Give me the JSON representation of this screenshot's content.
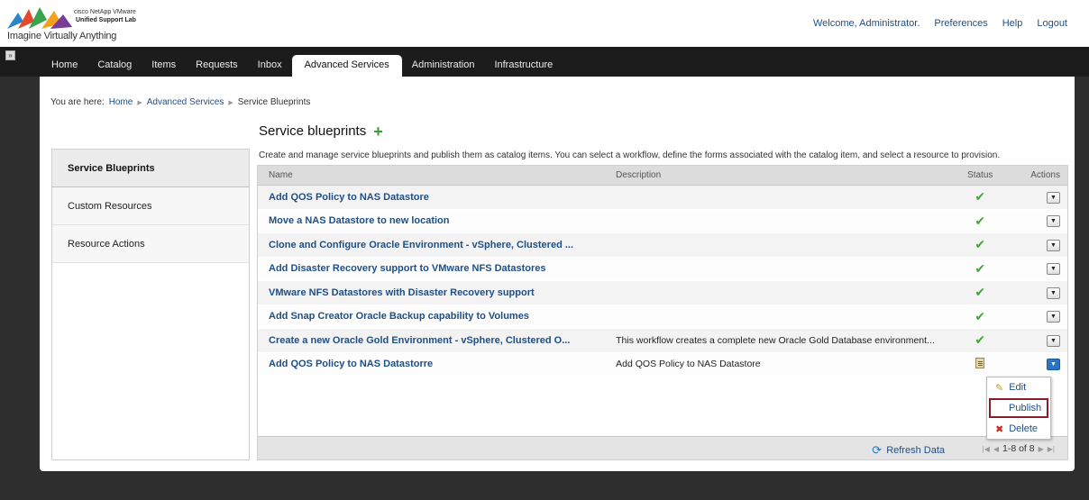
{
  "header": {
    "tagline": "Imagine Virtually Anything",
    "brand_small": "cisco  NetApp  VMware",
    "brand_lab": "Unified Support Lab",
    "welcome": "Welcome, Administrator.",
    "links": [
      "Preferences",
      "Help",
      "Logout"
    ]
  },
  "nav": {
    "toggle": "»",
    "tabs": [
      "Home",
      "Catalog",
      "Items",
      "Requests",
      "Inbox",
      "Advanced Services",
      "Administration",
      "Infrastructure"
    ],
    "active_tab": "Advanced Services"
  },
  "breadcrumb": {
    "prefix": "You are here:",
    "items": [
      "Home",
      "Advanced Services",
      "Service Blueprints"
    ]
  },
  "page": {
    "title": "Service blueprints",
    "description": "Create and manage service blueprints and publish them as catalog items. You can select a workflow, define the forms associated with the catalog item, and select a resource to provision."
  },
  "sidebar": {
    "items": [
      {
        "label": "Service Blueprints",
        "active": true
      },
      {
        "label": "Custom Resources",
        "active": false
      },
      {
        "label": "Resource Actions",
        "active": false
      }
    ]
  },
  "table": {
    "columns": [
      "Name",
      "Description",
      "Status",
      "Actions"
    ],
    "rows": [
      {
        "name": "Add QOS Policy to NAS Datastore",
        "description": "",
        "status": "published"
      },
      {
        "name": "Move a NAS Datastore to new location",
        "description": "",
        "status": "published"
      },
      {
        "name": "Clone and Configure Oracle Environment - vSphere, Clustered ...",
        "description": "",
        "status": "published"
      },
      {
        "name": "Add Disaster Recovery support to VMware NFS Datastores",
        "description": "",
        "status": "published"
      },
      {
        "name": "VMware NFS Datastores with Disaster Recovery support",
        "description": "",
        "status": "published"
      },
      {
        "name": "Add Snap Creator Oracle Backup capability to Volumes",
        "description": "",
        "status": "published"
      },
      {
        "name": "Create a new Oracle Gold Environment - vSphere, Clustered O...",
        "description": "This workflow creates a complete new Oracle Gold Database environment...",
        "status": "published"
      },
      {
        "name": "Add QOS Policy to NAS Datastorre",
        "description": "Add QOS Policy to NAS Datastore",
        "status": "draft"
      }
    ],
    "refresh_label": "Refresh Data",
    "pager_text": "1-8 of 8"
  },
  "context_menu": {
    "items": [
      "Edit",
      "Publish",
      "Delete"
    ],
    "highlighted": "Publish"
  },
  "colors": {
    "accent": "#1e4f86",
    "nav_bg": "#1c1c1c",
    "ok_green": "#46a43b",
    "highlight_border": "#8a1c2b"
  }
}
